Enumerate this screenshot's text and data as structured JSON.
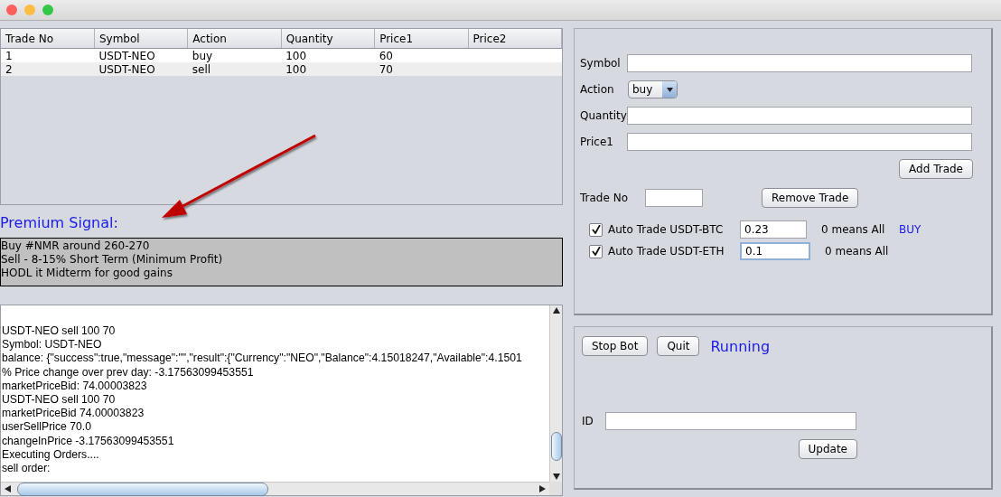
{
  "table": {
    "columns": [
      "Trade No",
      "Symbol",
      "Action",
      "Quantity",
      "Price1",
      "Price2"
    ],
    "rows": [
      [
        "1",
        "USDT-NEO",
        "buy",
        "100",
        "60"
      ],
      [
        "2",
        "USDT-NEO",
        "sell",
        "100",
        "70"
      ]
    ]
  },
  "signal": {
    "title": "Premium Signal:",
    "lines": [
      "Buy #NMR around 260-270",
      "Sell - 8-15% Short Term (Minimum Profit)",
      "HODL it Midterm for good gains"
    ]
  },
  "log": {
    "lines": [
      "USDT-NEO sell 100 70",
      "Symbol: USDT-NEO",
      "balance: {\"success\":true,\"message\":\"\",\"result\":{\"Currency\":\"NEO\",\"Balance\":4.15018247,\"Available\":4.1501",
      "% Price change over prev day: -3.17563099453551",
      "marketPriceBid: 74.00003823",
      "USDT-NEO sell 100 70",
      "marketPriceBid 74.00003823",
      "userSellPrice 70.0",
      "changeInPrice -3.17563099453551",
      "Executing Orders....",
      "sell order:"
    ]
  },
  "trade_form": {
    "symbol_label": "Symbol",
    "action_label": "Action",
    "action_value": "buy",
    "quantity_label": "Quantity",
    "price1_label": "Price1",
    "add_button": "Add Trade",
    "trade_no_label": "Trade No",
    "remove_button": "Remove Trade"
  },
  "auto_trades": [
    {
      "label": "Auto Trade USDT-BTC",
      "checked": true,
      "value": "0.23",
      "focused": false,
      "hint": "0 means All",
      "signal": "BUY"
    },
    {
      "label": "Auto Trade USDT-ETH",
      "checked": true,
      "value": "0.1",
      "focused": true,
      "hint": "0 means All"
    }
  ],
  "bot": {
    "stop_button": "Stop Bot",
    "quit_button": "Quit",
    "status": "Running",
    "id_label": "ID",
    "update_button": "Update"
  }
}
